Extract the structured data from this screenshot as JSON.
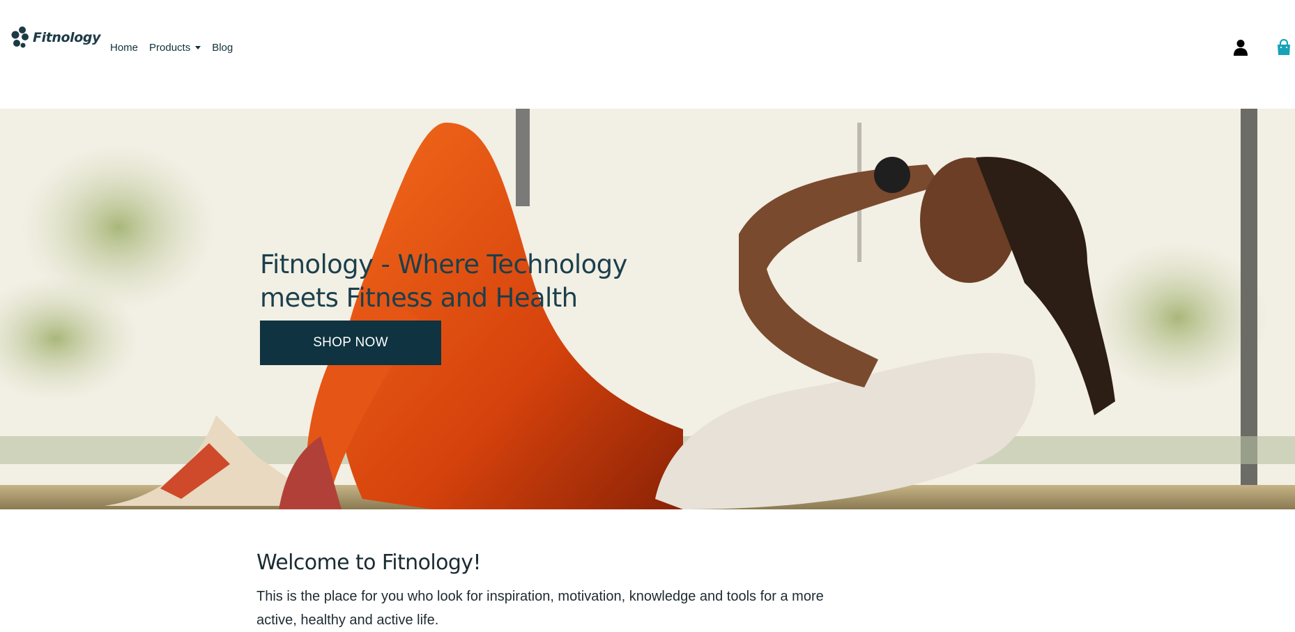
{
  "brand": {
    "name": "Fitnology"
  },
  "nav": {
    "items": [
      {
        "label": "Home"
      },
      {
        "label": "Products",
        "has_dropdown": true
      },
      {
        "label": "Blog"
      }
    ],
    "icons": [
      "user-icon",
      "shopping-bag-icon"
    ]
  },
  "hero": {
    "title": "Fitnology - Where Technology meets Fitness and Health",
    "button_label": "SHOP NOW"
  },
  "welcome": {
    "title": "Welcome to Fitnology!",
    "text": "This is the place for you who look for inspiration, motivation, knowledge and tools for a more active, healthy and active life."
  },
  "colors": {
    "primary": "#0f3340",
    "accent": "#17a2b8",
    "text": "#11303c"
  }
}
